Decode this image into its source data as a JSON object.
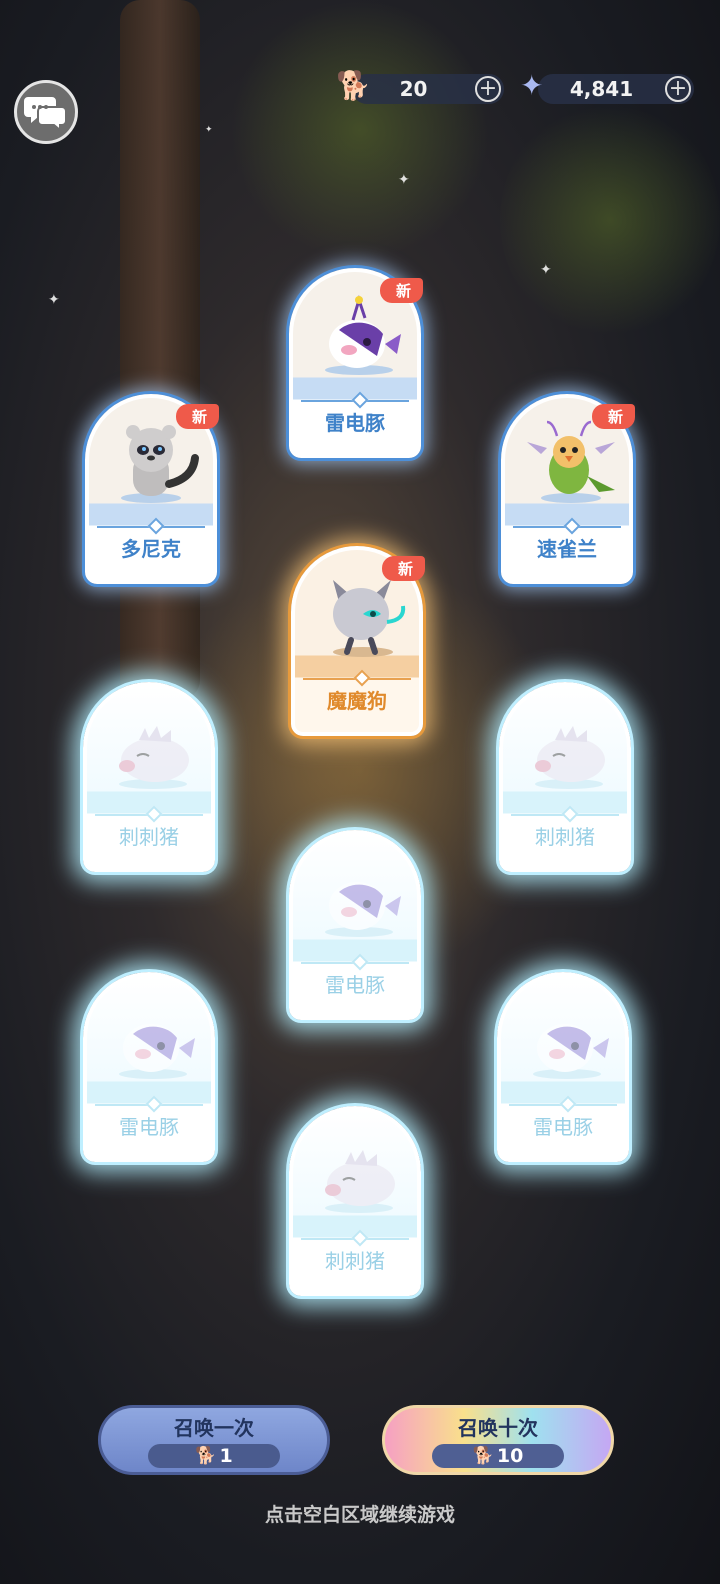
{
  "hud": {
    "ticket": {
      "icon": "dog-ticket-icon",
      "value": "20",
      "plus": "+"
    },
    "stars": {
      "icon": "star-gem-icon",
      "value": "4,841",
      "plus": "+"
    }
  },
  "cards": [
    {
      "name": "雷电豚",
      "badge": "新",
      "style": "blue",
      "creature": "purple-fish"
    },
    {
      "name": "多尼克",
      "badge": "新",
      "style": "blue",
      "creature": "gray-ferret"
    },
    {
      "name": "速雀兰",
      "badge": "新",
      "style": "blue",
      "creature": "green-bird"
    },
    {
      "name": "魔魔狗",
      "badge": "新",
      "style": "orange",
      "creature": "gray-dog"
    },
    {
      "name": "刺刺猪",
      "badge": "",
      "style": "pale",
      "creature": "pig"
    },
    {
      "name": "刺刺猪",
      "badge": "",
      "style": "pale",
      "creature": "pig"
    },
    {
      "name": "雷电豚",
      "badge": "",
      "style": "pale",
      "creature": "fish"
    },
    {
      "name": "雷电豚",
      "badge": "",
      "style": "pale",
      "creature": "fish"
    },
    {
      "name": "雷电豚",
      "badge": "",
      "style": "pale",
      "creature": "fish"
    },
    {
      "name": "刺刺猪",
      "badge": "",
      "style": "pale",
      "creature": "pig"
    }
  ],
  "buttons": {
    "summon_once": {
      "label": "召唤一次",
      "cost": "1"
    },
    "summon_ten": {
      "label": "召唤十次",
      "cost": "10"
    }
  },
  "hint": "点击空白区域继续游戏",
  "colors": {
    "new_badge": "#ef5a4a",
    "card_border": "#4d8fd8",
    "highlight_border": "#e79a3c"
  }
}
